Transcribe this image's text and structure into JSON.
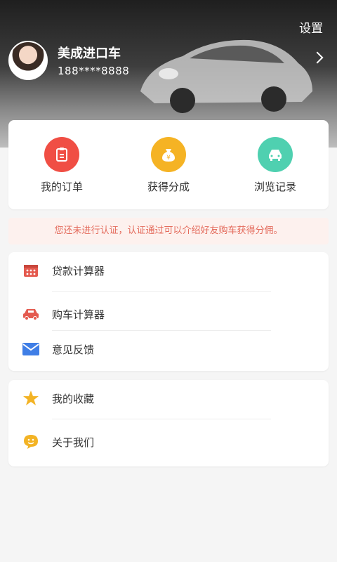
{
  "header": {
    "settings_label": "设置",
    "user_name": "美成进口车",
    "user_phone": "188****8888"
  },
  "quick_actions": [
    {
      "label": "我的订单",
      "icon": "order-clipboard-icon",
      "color": "#f04e44"
    },
    {
      "label": "获得分成",
      "icon": "money-bag-icon",
      "color": "#f5b324"
    },
    {
      "label": "浏览记录",
      "icon": "car-front-icon",
      "color": "#4fd0b0"
    }
  ],
  "notice": "您还未进行认证，认证通过可以介绍好友购车获得分佣。",
  "menu_group1": [
    {
      "label": "贷款计算器",
      "icon": "calculator-icon"
    },
    {
      "label": "购车计算器",
      "icon": "car-icon"
    },
    {
      "label": "意见反馈",
      "icon": "envelope-icon"
    }
  ],
  "menu_group2": [
    {
      "label": "我的收藏",
      "icon": "star-icon"
    },
    {
      "label": "关于我们",
      "icon": "smiley-chat-icon"
    }
  ],
  "colors": {
    "red": "#e45a4f",
    "blue": "#3f7ee6",
    "gold": "#f3b324",
    "notice_text": "#e46b5c",
    "notice_bg": "#fdf1ee"
  }
}
